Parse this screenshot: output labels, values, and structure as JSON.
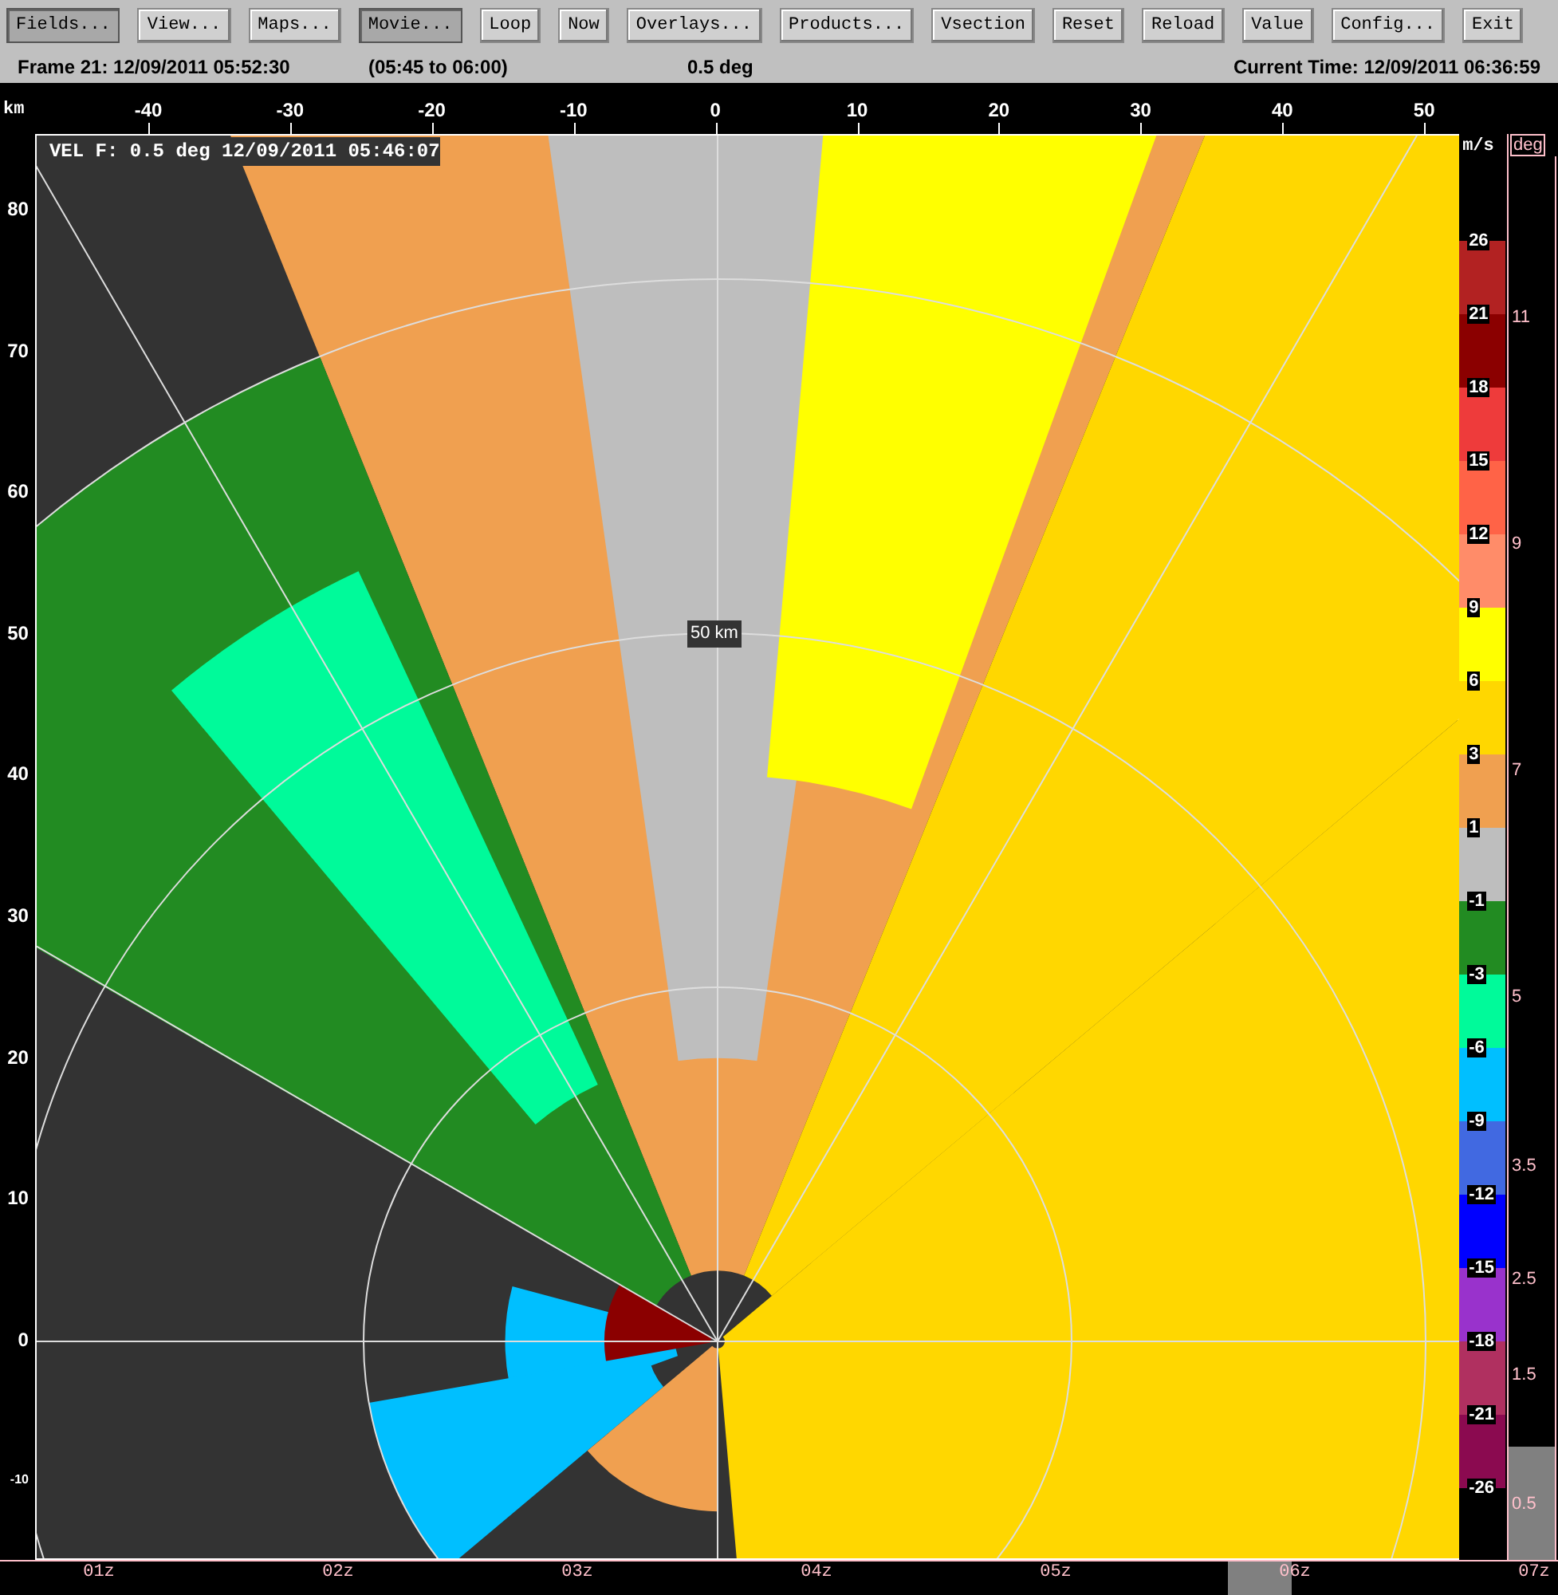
{
  "toolbar": [
    {
      "label": "Fields...",
      "selected": true
    },
    {
      "label": "View...",
      "selected": false
    },
    {
      "label": "Maps...",
      "selected": false
    },
    {
      "label": "Movie...",
      "selected": true
    },
    {
      "label": "Loop",
      "selected": false
    },
    {
      "label": "Now",
      "selected": false
    },
    {
      "label": "Overlays...",
      "selected": false
    },
    {
      "label": "Products...",
      "selected": false
    },
    {
      "label": "Vsection",
      "selected": false
    },
    {
      "label": "Reset",
      "selected": false
    },
    {
      "label": "Reload",
      "selected": false
    },
    {
      "label": "Value",
      "selected": false
    },
    {
      "label": "Config...",
      "selected": false
    },
    {
      "label": "Exit",
      "selected": false
    }
  ],
  "status_bar": {
    "frame": "Frame 21: 12/09/2011 05:52:30",
    "range": "(05:45 to 06:00)",
    "elevation": "0.5 deg",
    "current_time": "Current Time: 12/09/2011 06:36:59"
  },
  "plot": {
    "unit": "km",
    "x_ticks": [
      "-40",
      "-30",
      "-20",
      "-10",
      "0",
      "10",
      "20",
      "30",
      "40",
      "50"
    ],
    "y_ticks": [
      "80",
      "70",
      "60",
      "50",
      "40",
      "30",
      "20",
      "10",
      "0",
      "-10"
    ],
    "overlay_title": "VEL F: 0.5 deg 12/09/2011 05:46:07",
    "ring_label": "50 km"
  },
  "velocity_scale": {
    "unit": "m/s",
    "bottom_label": "-26",
    "items": [
      {
        "label": "26",
        "color": "#b22222"
      },
      {
        "label": "21",
        "color": "#8b0000"
      },
      {
        "label": "18",
        "color": "#ee3b3b"
      },
      {
        "label": "15",
        "color": "#ff6347"
      },
      {
        "label": "12",
        "color": "#ff8c69"
      },
      {
        "label": "9",
        "color": "#ffff00"
      },
      {
        "label": "6",
        "color": "#ffd700"
      },
      {
        "label": "3",
        "color": "#f0a050"
      },
      {
        "label": "1",
        "color": "#bebebe"
      },
      {
        "label": "-1",
        "color": "#228b22"
      },
      {
        "label": "-3",
        "color": "#00fa9a"
      },
      {
        "label": "-6",
        "color": "#00bfff"
      },
      {
        "label": "-9",
        "color": "#4169e1"
      },
      {
        "label": "-12",
        "color": "#0000ff"
      },
      {
        "label": "-15",
        "color": "#9932cc"
      },
      {
        "label": "-18",
        "color": "#b03060"
      },
      {
        "label": "-21",
        "color": "#8b0a50"
      }
    ]
  },
  "elevation_scale": {
    "unit": "deg",
    "ticks": [
      {
        "label": "11",
        "selected": false
      },
      {
        "label": "9",
        "selected": false
      },
      {
        "label": "7",
        "selected": false
      },
      {
        "label": "5",
        "selected": false
      },
      {
        "label": "3.5",
        "selected": false
      },
      {
        "label": "2.5",
        "selected": false
      },
      {
        "label": "1.5",
        "selected": false
      },
      {
        "label": "0.5",
        "selected": true
      }
    ]
  },
  "time_axis": [
    "01z",
    "02z",
    "03z",
    "04z",
    "05z",
    "06z",
    "07z"
  ]
}
